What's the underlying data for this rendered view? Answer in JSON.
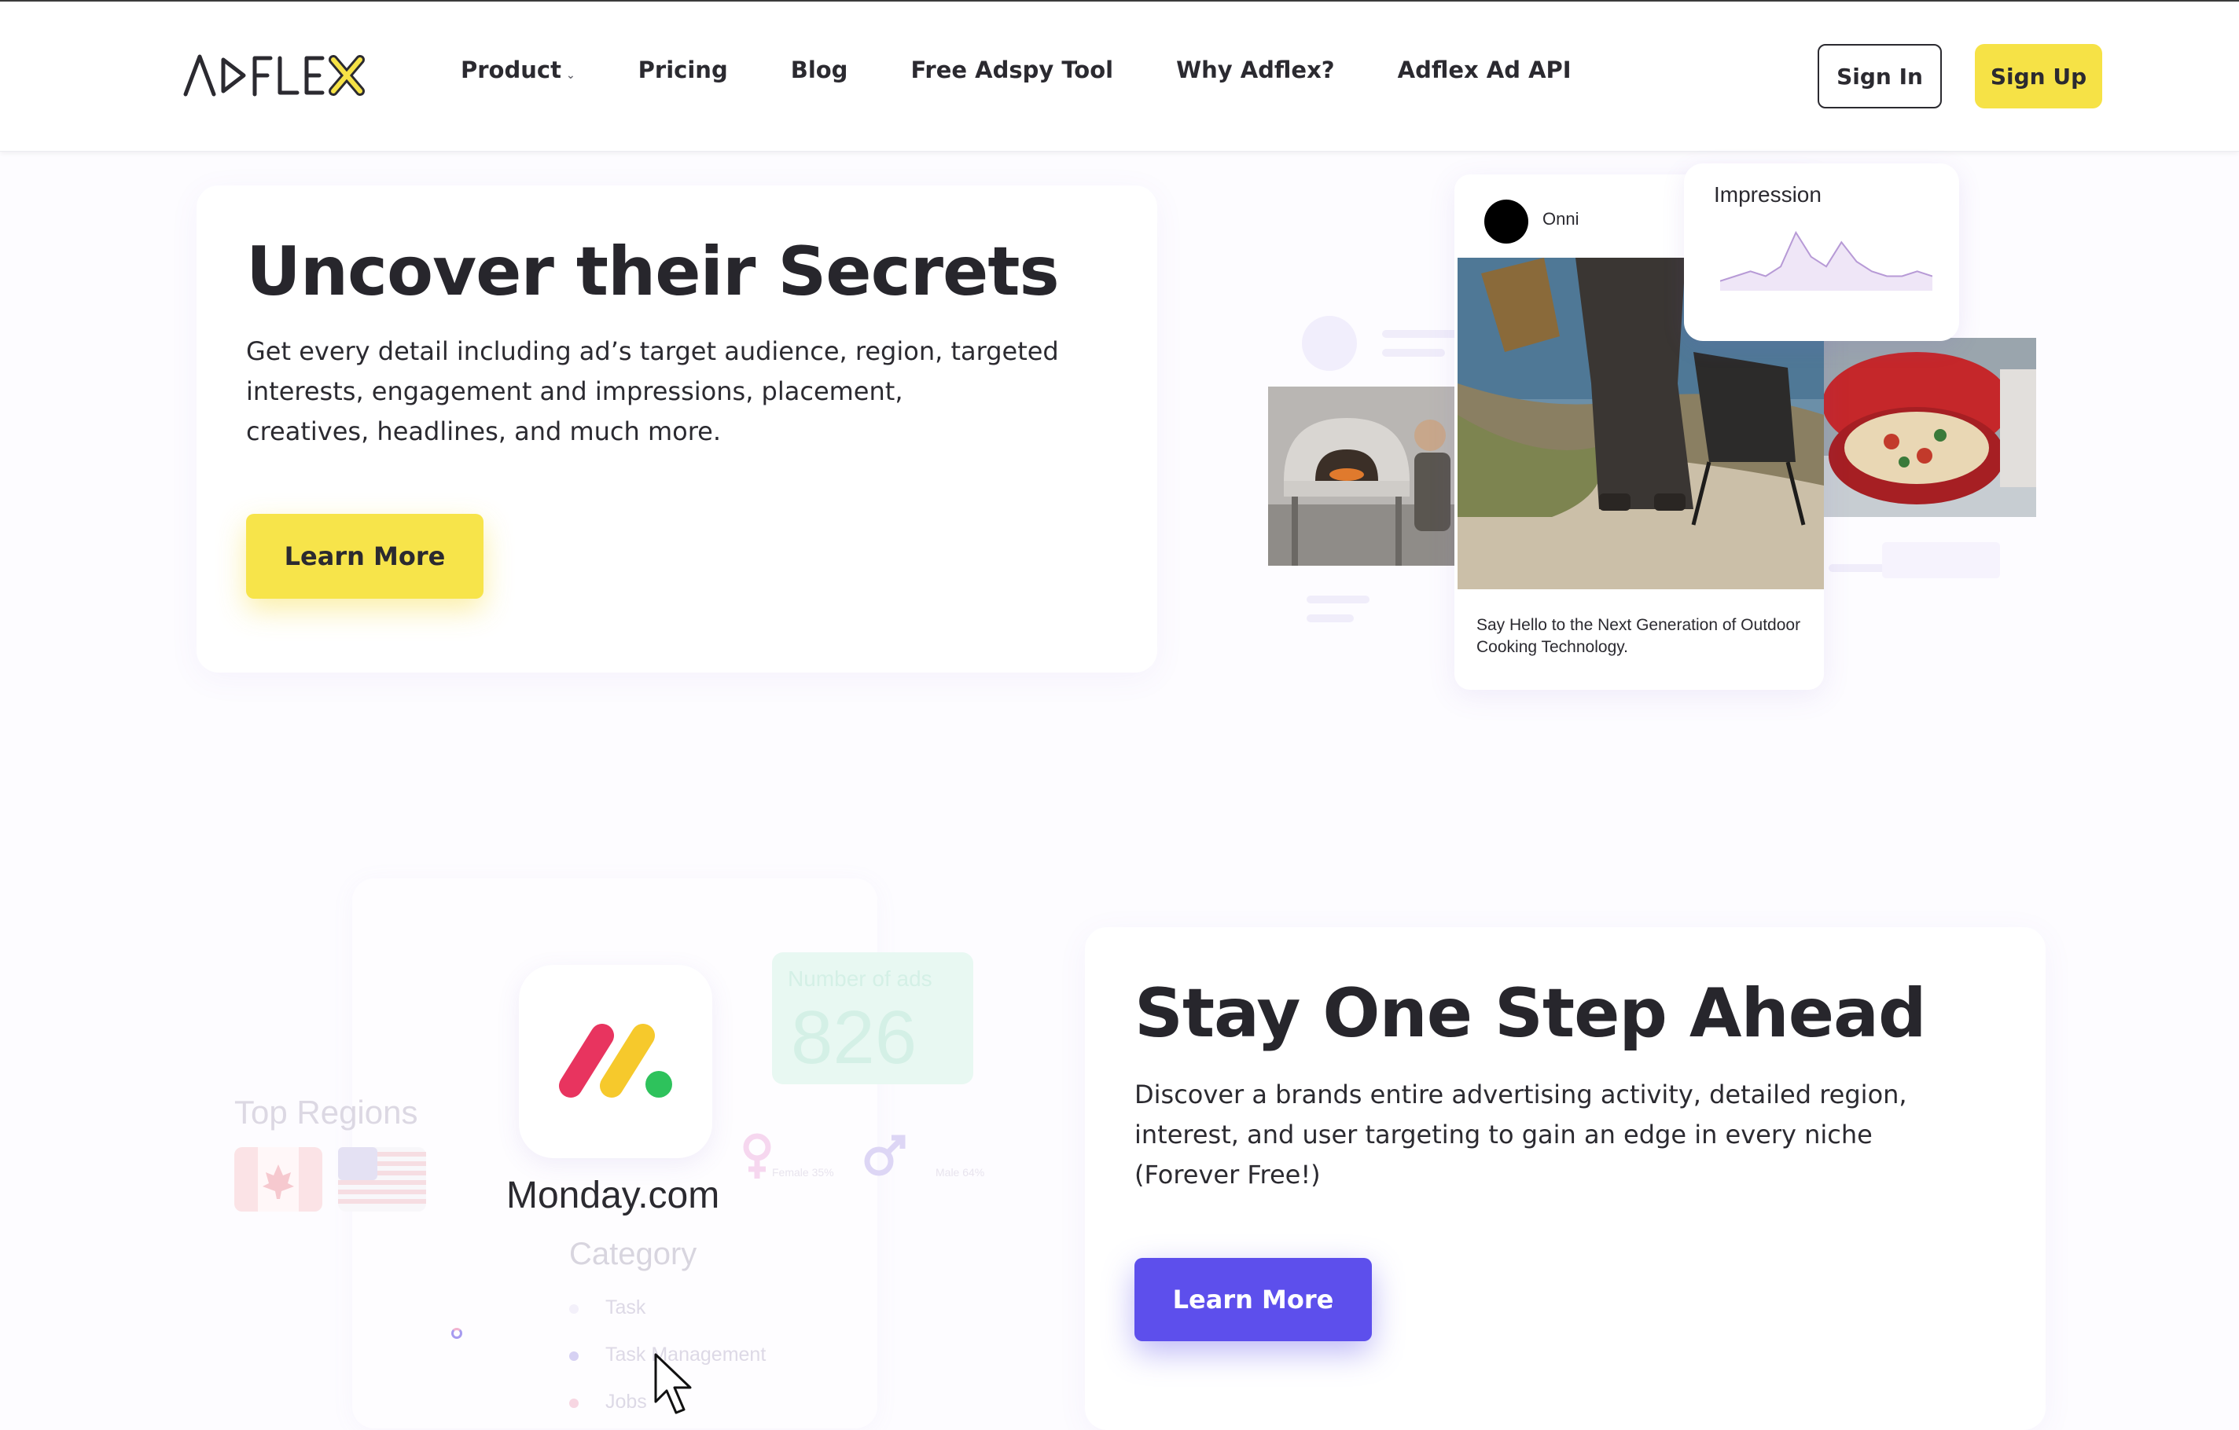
{
  "nav": {
    "logo_text": "ADFLEX",
    "items": [
      {
        "label": "Product",
        "has_dropdown": true
      },
      {
        "label": "Pricing"
      },
      {
        "label": "Blog"
      },
      {
        "label": "Free Adspy Tool"
      },
      {
        "label": "Why Adflex?"
      },
      {
        "label": "Adflex Ad API"
      }
    ],
    "sign_in": "Sign In",
    "sign_up": "Sign Up"
  },
  "section1": {
    "title": "Uncover their Secrets",
    "paragraph_lines": [
      "Get every detail including ad’s target audience, region, targeted",
      "interests, engagement and impressions, placement,",
      "creatives, headlines, and much more."
    ],
    "button": "Learn More",
    "post": {
      "author": "Onni",
      "caption": "Say Hello to the Next Generation of Outdoor Cooking Technology."
    },
    "impression": {
      "title": "Impression",
      "series": [
        2,
        3,
        4,
        3,
        5,
        12,
        7,
        5,
        10,
        6,
        4,
        3,
        3,
        4,
        3
      ]
    }
  },
  "section2": {
    "title": "Stay One Step Ahead",
    "paragraph_lines": [
      "Discover a brands entire advertising activity, detailed region,",
      "interest, and user targeting to gain an edge in every niche",
      "(Forever Free!)"
    ],
    "button": "Learn More",
    "brand": {
      "name": "Monday.com",
      "category_label": "Category",
      "categories": [
        "Task",
        "Task Management",
        "Jobs"
      ]
    },
    "top_regions_label": "Top Regions",
    "ads_stat": {
      "label": "Number of ads",
      "value": "826"
    },
    "gender": {
      "female": "Female 35%",
      "male": "Male 64%"
    }
  },
  "colors": {
    "accent_yellow": "#f6e246",
    "accent_purple": "#5d4fec",
    "text_dark": "#27262c"
  }
}
